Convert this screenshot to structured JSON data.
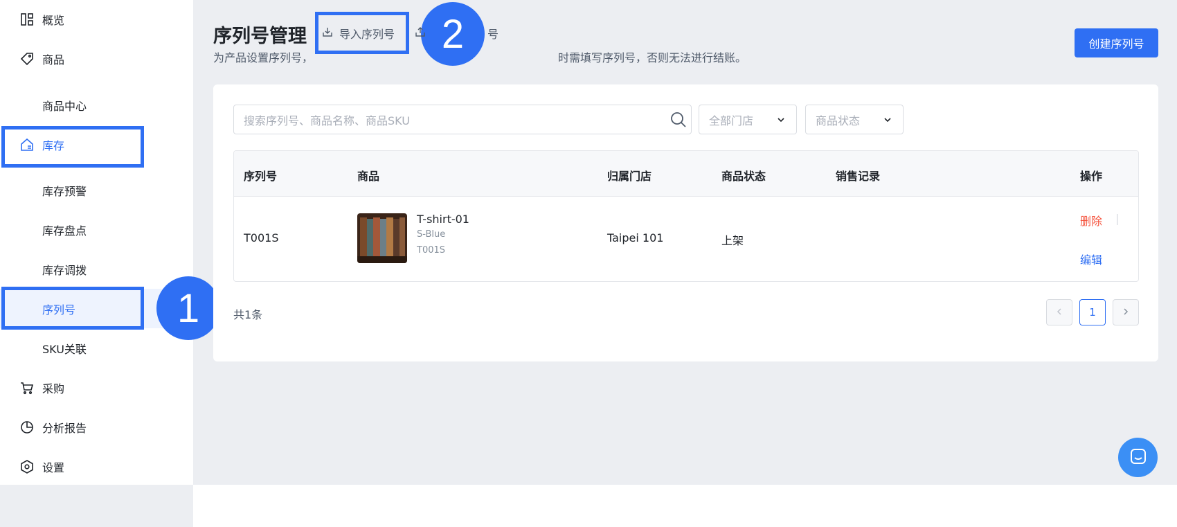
{
  "sidebar": {
    "items": [
      {
        "label": "概览",
        "icon": "dashboard-icon"
      },
      {
        "label": "商品",
        "icon": "tag-icon"
      },
      {
        "label": "商品中心"
      },
      {
        "label": "库存",
        "icon": "home-icon"
      },
      {
        "label": "库存预警"
      },
      {
        "label": "库存盘点"
      },
      {
        "label": "库存调拨"
      },
      {
        "label": "序列号"
      },
      {
        "label": "SKU关联"
      },
      {
        "label": "采购",
        "icon": "cart-icon"
      },
      {
        "label": "分析报告",
        "icon": "pie-chart-icon"
      },
      {
        "label": "设置",
        "icon": "settings-icon"
      }
    ]
  },
  "annotations": {
    "badge1": "1",
    "badge2": "2"
  },
  "header": {
    "title": "序列号管理",
    "import_label": "导入序列号",
    "export_label": "号",
    "subtitle_a": "为产品设置序列号，",
    "subtitle_b": "时需填写序列号，否则无法进行结账。",
    "create_label": "创建序列号"
  },
  "filters": {
    "search_placeholder": "搜索序列号、商品名称、商品SKU",
    "store_placeholder": "全部门店",
    "status_placeholder": "商品状态"
  },
  "table": {
    "columns": [
      "序列号",
      "商品",
      "归属门店",
      "商品状态",
      "销售记录",
      "操作"
    ],
    "rows": [
      {
        "serial": "T001S",
        "product_name": "T-shirt-01",
        "variant": "S-Blue",
        "sku": "T001S",
        "store": "Taipei 101",
        "status": "上架",
        "sales": "",
        "delete_label": "删除",
        "edit_label": "编辑"
      }
    ]
  },
  "pagination": {
    "total": "共1条",
    "current": "1"
  },
  "colors": {
    "accent": "#2f6ff3",
    "danger": "#f5533d"
  }
}
